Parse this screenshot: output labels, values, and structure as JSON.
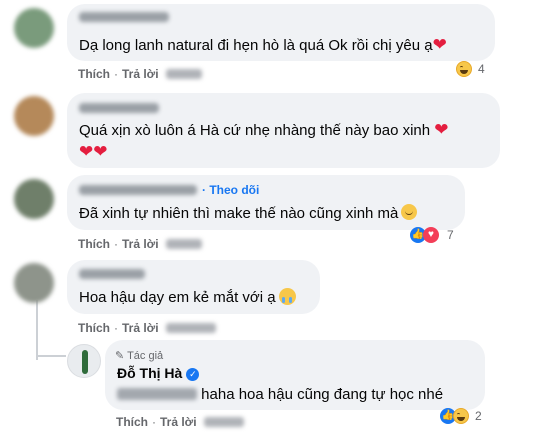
{
  "colors": {
    "link": "#1877f2",
    "bubble_bg": "#f0f2f5",
    "meta_text": "#65676b"
  },
  "actions": {
    "like": "Thích",
    "reply": "Trả lời",
    "follow": "Theo dõi",
    "author_badge": "Tác giả"
  },
  "comments": [
    {
      "name": "",
      "text": "Dạ long lanh natural đi hẹn hò là quá Ok rồi chị yêu ạ",
      "reactions": {
        "types": [
          "haha-icon"
        ],
        "count": "4"
      }
    },
    {
      "name": "",
      "text1": "Quá xịn xò luôn á Hà cứ nhẹ nhàng thế này bao xinh",
      "text2": "",
      "reactions": null
    },
    {
      "name": "",
      "text": "Đã xinh tự nhiên thì make thế nào cũng xinh mà",
      "reactions": {
        "types": [
          "like-icon",
          "love-icon"
        ],
        "count": "7"
      }
    },
    {
      "name": "",
      "text": "Hoa hậu dạy em kẻ mắt với ạ",
      "reactions": null
    }
  ],
  "reply": {
    "name": "Đỗ Thị Hà",
    "text": "haha hoa hậu cũng đang tự học nhé",
    "reactions": {
      "types": [
        "like-icon",
        "haha-icon"
      ],
      "count": "2"
    }
  }
}
